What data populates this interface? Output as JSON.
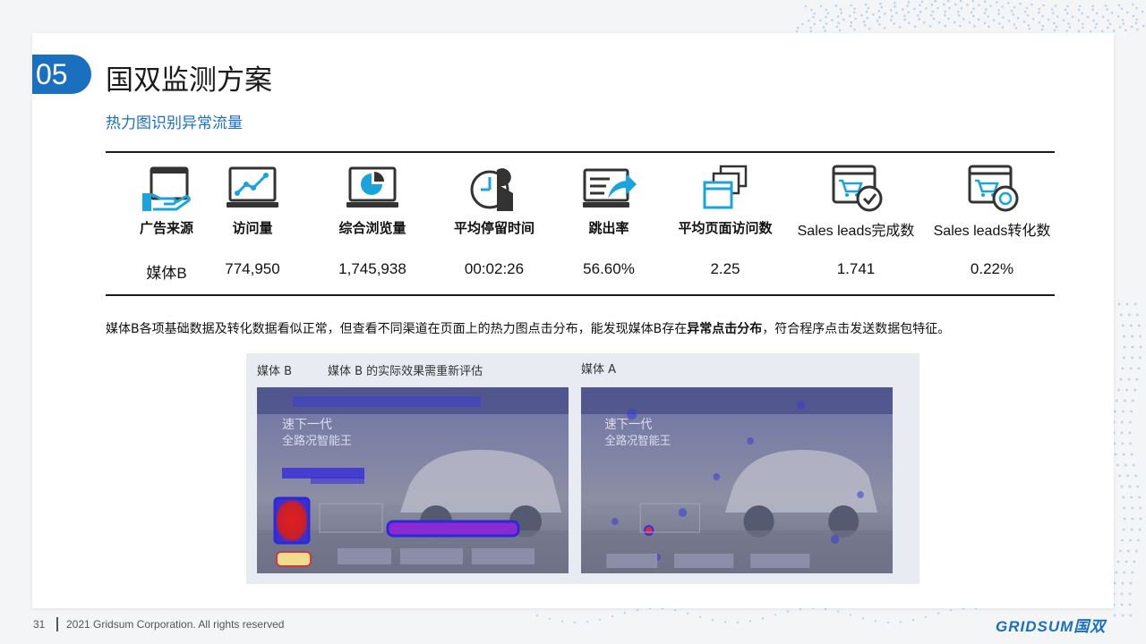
{
  "slide": {
    "number": "05",
    "title": "国双监测方案",
    "subtitle": "热力图识别异常流量"
  },
  "metrics": [
    {
      "icon": "hand-window-icon",
      "label": "广告来源",
      "value": "媒体B"
    },
    {
      "icon": "line-chart-monitor-icon",
      "label": "访问量",
      "value": "774,950"
    },
    {
      "icon": "pie-chart-monitor-icon",
      "label": "综合浏览量",
      "value": "1,745,938"
    },
    {
      "icon": "clock-person-icon",
      "label": "平均停留时间",
      "value": "00:02:26"
    },
    {
      "icon": "share-monitor-icon",
      "label": "跳出率",
      "value": "56.60%"
    },
    {
      "icon": "stacked-windows-icon",
      "label": "平均页面访问数",
      "value": "2.25"
    },
    {
      "icon": "cart-check-icon",
      "label": "Sales leads完成数",
      "value": "1.741"
    },
    {
      "icon": "cart-convert-icon",
      "label": "Sales leads转化数",
      "value": "0.22%"
    }
  ],
  "description": {
    "before": "媒体B各项基础数据及转化数据看似正常，但查看不同渠道在页面上的热力图点击分布，能发现媒体B存在",
    "emphasis": "异常点击分布",
    "after": "，符合程序点击发送数据包特征。"
  },
  "heatmaps": {
    "left_label": "媒体 B",
    "left_caption": "媒体 B 的实际效果需重新评估",
    "right_label": "媒体 A",
    "screen_headline": "速下一代",
    "screen_subline": "全路况智能王"
  },
  "footer": {
    "page": "31",
    "copyright": "2021 Gridsum Corporation. All rights reserved",
    "logo": "GRIDSUM国双"
  },
  "colors": {
    "accent": "#1a6fbe",
    "icon_blue": "#1aa3dd",
    "icon_dark": "#333333"
  }
}
